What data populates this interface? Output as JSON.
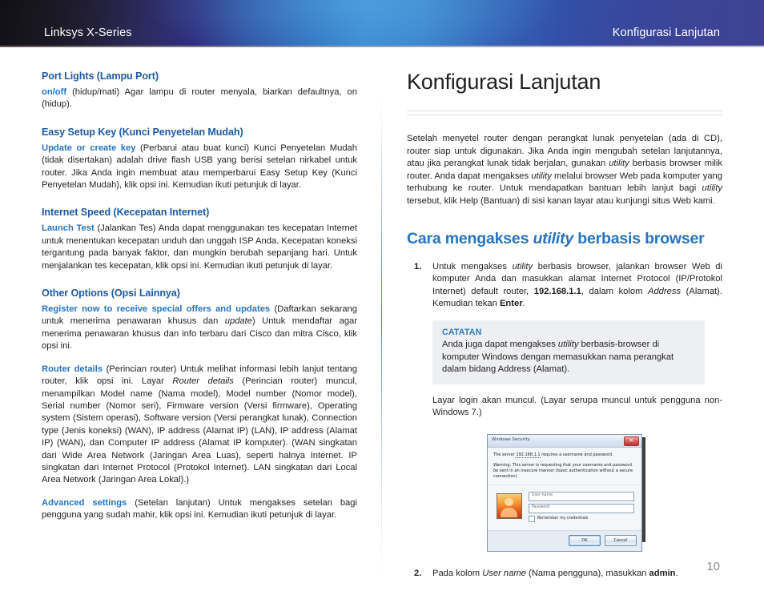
{
  "header": {
    "left_title": "Linksys X-Series",
    "right_title": "Konfigurasi Lanjutan"
  },
  "left_column": {
    "sections": [
      {
        "heading": "Port Lights (Lampu Port)",
        "lead": "on/off",
        "body": " (hidup/mati) Agar lampu di router menyala, biarkan defaultnya, on (hidup)."
      },
      {
        "heading": "Easy Setup Key (Kunci Penyetelan Mudah)",
        "lead": "Update or create key",
        "body": " (Perbarui atau buat kunci) Kunci Penyetelan Mudah (tidak disertakan) adalah drive flash USB yang berisi setelan nirkabel untuk router. Jika Anda ingin membuat atau memperbarui Easy Setup Key (Kunci Penyetelan Mudah), klik opsi ini. Kemudian ikuti petunjuk di layar."
      },
      {
        "heading": "Internet Speed (Kecepatan Internet)",
        "lead": "Launch Test",
        "body": "  (Jalankan Tes) Anda dapat menggunakan tes kecepatan Internet untuk menentukan kecepatan unduh dan unggah ISP Anda. Kecepatan koneksi tergantung pada banyak faktor, dan mungkin berubah sepanjang hari. Untuk menjalankan tes kecepatan, klik opsi ini. Kemudian ikuti petunjuk di layar."
      },
      {
        "heading": "Other Options (Opsi Lainnya)"
      }
    ],
    "other_options_paragraphs": [
      {
        "lead": "Register now to receive special offers and updates",
        "part1": " (Daftarkan sekarang untuk menerima penawaran khusus dan ",
        "italic": "update",
        "part2": ") Untuk mendaftar agar menerima penawaran khusus dan info terbaru dari Cisco dan mitra Cisco, klik opsi ini."
      },
      {
        "lead": "Router details",
        "part1": "  (Perincian router) Untuk melihat informasi lebih lanjut tentang router, klik opsi ini. Layar ",
        "italic": "Router details",
        "part2": " (Perincian router) muncul, menampilkan Model name (Nama model), Model number (Nomor model), Serial number (Nomor seri), Firmware version (Versi firmware), Operating system (Sistem operasi), Software version (Versi perangkat lunak), Connection type (Jenis koneksi) (WAN), IP address (Alamat IP) (LAN), IP address (Alamat IP) (WAN), dan Computer IP address (Alamat IP komputer). (WAN singkatan dari Wide Area Network (Jaringan Area Luas), seperti halnya Internet. IP singkatan dari Internet Protocol (Protokol Internet). LAN singkatan dari Local Area Network (Jaringan Area Lokal).)"
      },
      {
        "lead": "Advanced settings",
        "part1": " (Setelan lanjutan) Untuk mengakses setelan bagi pengguna yang sudah mahir, klik opsi ini. Kemudian ikuti petunjuk di layar.",
        "italic": "",
        "part2": ""
      }
    ]
  },
  "right_column": {
    "page_title": "Konfigurasi Lanjutan",
    "intro": {
      "part1": "Setelah menyetel router dengan perangkat lunak penyetelan (ada di CD), router siap untuk digunakan. Jika Anda ingin mengubah setelan lanjutannya, atau jika perangkat lunak tidak berjalan, gunakan ",
      "italic1": "utility",
      "part2": " berbasis browser milik router. Anda dapat mengakses ",
      "italic2": "utility",
      "part3": " melalui browser Web pada komputer yang terhubung ke router. Untuk mendapatkan bantuan lebih lanjut bagi ",
      "italic3": "utility",
      "part4": " tersebut, klik Help (Bantuan) di sisi kanan layar atau kunjungi situs Web kami."
    },
    "section_heading": {
      "part1": "Cara mengakses ",
      "italic": "utility",
      "part2": " berbasis browser"
    },
    "step1": {
      "number": "1.",
      "part1": "Untuk mengakses ",
      "italic1": "utility",
      "part2": " berbasis browser, jalankan browser Web di komputer Anda dan masukkan alamat Internet Protocol (IP/Protokol Internet) default router, ",
      "bold1": "192.168.1.1",
      "part3": ", dalam kolom ",
      "italic2": "Address",
      "part4": " (Alamat). Kemudian tekan ",
      "bold2": "Enter",
      "part5": "."
    },
    "note": {
      "title": "CATATAN",
      "part1": "Anda juga dapat mengakses ",
      "italic": "utility",
      "part2": " berbasis-browser di komputer Windows dengan memasukkan nama perangkat dalam bidang Address (Alamat)."
    },
    "after_note": "Layar login akan muncul. (Layar serupa muncul untuk pengguna non-Windows 7.)",
    "step2": {
      "number": "2.",
      "part1": "Pada kolom ",
      "italic": "User name",
      "part2": " (Nama pengguna), masukkan ",
      "bold": "admin",
      "part3": "."
    },
    "page_number": "10"
  },
  "dialog_figure": {
    "title": "Windows Security",
    "close_label": "close",
    "message_prefix": "The server ",
    "message_ip": "192.168.1.1",
    "message_suffix": " requires a username and password.",
    "warning": "Warning: This server is requesting that your username and password be sent in an insecure manner (basic authentication without a secure connection).",
    "username_placeholder": "User name",
    "password_placeholder": "Password",
    "remember_label": "Remember my credentials",
    "ok_label": "OK",
    "cancel_label": "Cancel"
  },
  "colors": {
    "accent_blue": "#2574c4",
    "heading_blue": "#1f5ba6",
    "note_bg": "#edeff1",
    "body_text": "#231f20",
    "page_number": "#8d8d8d"
  }
}
